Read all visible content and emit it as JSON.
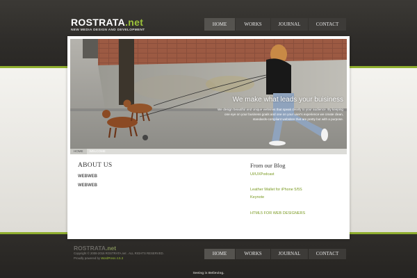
{
  "brand": {
    "name": "ROSTRATA",
    "ext": ".net",
    "tagline": "NEW MEDIA DESIGN AND DEVELOPMENT"
  },
  "nav": {
    "items": [
      {
        "label": "HOME",
        "active": true
      },
      {
        "label": "WORKS",
        "active": false
      },
      {
        "label": "JOURNAL",
        "active": false
      },
      {
        "label": "CONTACT",
        "active": false
      }
    ]
  },
  "hero": {
    "tagline": "We make what leads your buisiness",
    "description": "We design beautiful and unique websites that speak clearly to your audience. By keeping one eye on your business goals and one on your user's experience we create clean, standards-compliant websites that are pretty but with a purpose."
  },
  "breadcrumb": {
    "home": "HOME",
    "current": "WELCOME"
  },
  "about": {
    "title": "ABOUT US",
    "items": [
      "WEBWEB",
      "WEBWEB"
    ]
  },
  "blog": {
    "title": "From our Blog",
    "links": [
      "UI/UXPodcast",
      "Leather Wallet for iPhone 5/5S",
      "Keynote",
      "HTML5 FOR WEB DESIGNERS"
    ]
  },
  "footer": {
    "logo_name": "ROSTRATA",
    "logo_ext": ".net",
    "copyright": "Copyright © 2008-2016 ROSTRATA.net . ALL RIGHTS RESERVED.",
    "powered_prefix": "Proudly powered by",
    "powered_link": "WordPress 4.5.3",
    "nav": [
      "HOME",
      "WORKS",
      "JOURNAL",
      "CONTACT"
    ],
    "slogan": "Seeing is Believing."
  },
  "colors": {
    "accent_green": "#8fae2e",
    "dark_band": "#2f2d2a",
    "link_green": "#7a9a22"
  }
}
